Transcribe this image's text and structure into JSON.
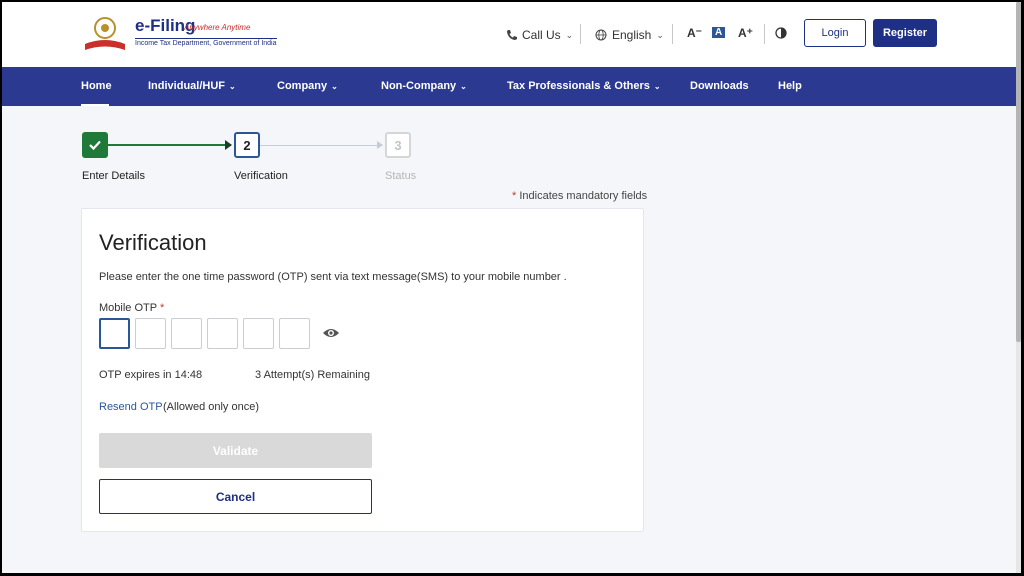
{
  "header": {
    "logo_title": "e-Filing",
    "logo_tagline": "Anywhere Anytime",
    "logo_subtitle": "Income Tax Department, Government of India",
    "call_us": "Call Us",
    "language": "English",
    "font_decrease": "A⁻",
    "font_default": "A",
    "font_increase": "A⁺",
    "login": "Login",
    "register": "Register"
  },
  "nav": {
    "items": [
      {
        "label": "Home",
        "dropdown": false
      },
      {
        "label": "Individual/HUF",
        "dropdown": true
      },
      {
        "label": "Company",
        "dropdown": true
      },
      {
        "label": "Non-Company",
        "dropdown": true
      },
      {
        "label": "Tax Professionals & Others",
        "dropdown": true
      },
      {
        "label": "Downloads",
        "dropdown": false
      },
      {
        "label": "Help",
        "dropdown": false
      }
    ]
  },
  "stepper": {
    "steps": [
      {
        "number": "1",
        "label": "Enter Details",
        "state": "done"
      },
      {
        "number": "2",
        "label": "Verification",
        "state": "active"
      },
      {
        "number": "3",
        "label": "Status",
        "state": "pending"
      }
    ]
  },
  "mandatory_note": "Indicates mandatory fields",
  "required_mark": "*",
  "form": {
    "title": "Verification",
    "description": "Please enter the one time password (OTP) sent via text message(SMS) to your mobile number .",
    "otp_label": "Mobile OTP",
    "otp_digits": [
      "",
      "",
      "",
      "",
      "",
      ""
    ],
    "expires": "OTP expires in 14:48",
    "attempts": "3 Attempt(s) Remaining",
    "resend": "Resend OTP",
    "resend_note": "(Allowed only once)",
    "validate": "Validate",
    "cancel": "Cancel"
  },
  "colors": {
    "primary": "#2b3990",
    "success": "#1f7a3a",
    "required": "#d0342c",
    "link": "#2b5797"
  }
}
